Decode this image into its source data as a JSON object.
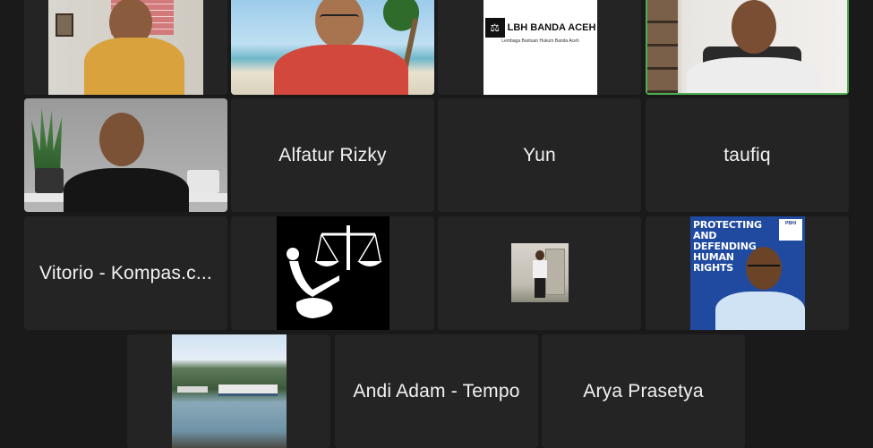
{
  "participants": [
    {
      "name": "",
      "video": "man-yellow-shirt-brick-wall"
    },
    {
      "name": "",
      "video": "man-red-shirt-beach-background"
    },
    {
      "name": "",
      "video": "lbh-banda-aceh-logo",
      "logo_title": "LBH BANDA ACEH",
      "logo_subtitle": "Lembaga Bantuan Hukum Banda Aceh"
    },
    {
      "name": "",
      "video": "man-white-shirt-speaking",
      "active_speaker": true
    },
    {
      "name": "",
      "video": "man-black-shirt-plants"
    },
    {
      "name": "Alfatur Rizky"
    },
    {
      "name": "Yun"
    },
    {
      "name": "taufiq"
    },
    {
      "name": "Vitorio - Kompas.c...",
      "full_name": "Vitorio - Kompas.c..."
    },
    {
      "name": "",
      "video": "justice-scales-figure"
    },
    {
      "name": "",
      "video": "small-photo-person-standing"
    },
    {
      "name": "",
      "video": "poster-protecting-human-rights",
      "poster_text": "PROTECTING AND DEFENDING HUMAN RIGHTS",
      "poster_badge": "PBHI"
    },
    {
      "name": "",
      "video": "boats-harbor-photo"
    },
    {
      "name": "Andi Adam - Tempo"
    },
    {
      "name": "Arya Prasetya"
    }
  ],
  "colors": {
    "background": "#1a1a1a",
    "tile": "#242424",
    "active_border": "#4caf50",
    "name_text": "#f2f2f2"
  }
}
